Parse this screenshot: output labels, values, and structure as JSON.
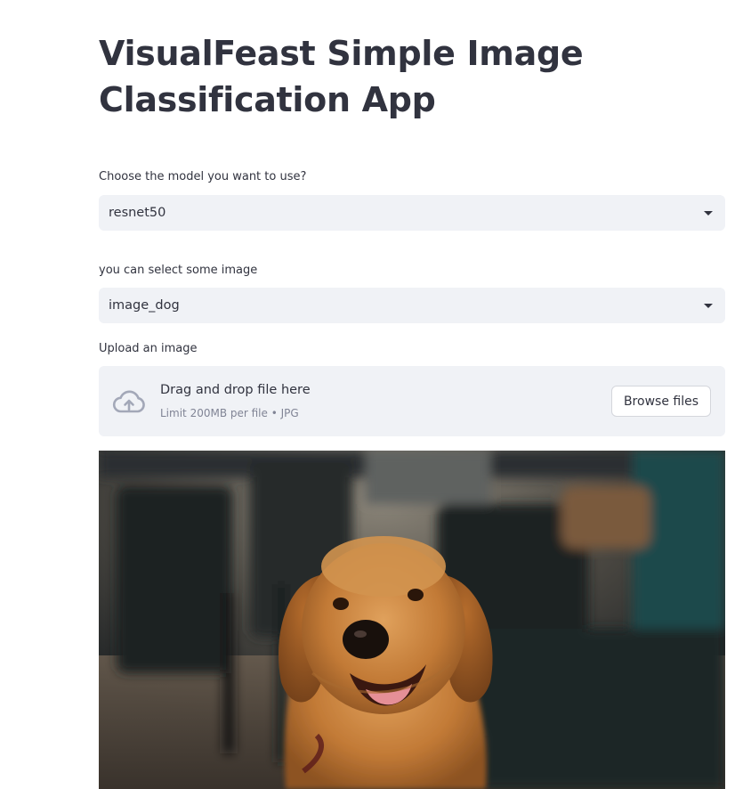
{
  "app": {
    "title": "VisualFeast Simple Image Classification App"
  },
  "model_select": {
    "label": "Choose the model you want to use?",
    "value": "resnet50"
  },
  "image_select": {
    "label": "you can select some image",
    "value": "image_dog"
  },
  "uploader": {
    "label": "Upload an image",
    "drop_text": "Drag and drop file here",
    "limit_text": "Limit 200MB per file • JPG",
    "browse_label": "Browse files",
    "icon": "cloud-upload-icon"
  },
  "preview": {
    "subject": "golden retriever photo"
  },
  "colors": {
    "input_bg": "#f0f2f6",
    "text": "#31333f",
    "muted": "#808495",
    "icon": "#a3a8b8"
  }
}
